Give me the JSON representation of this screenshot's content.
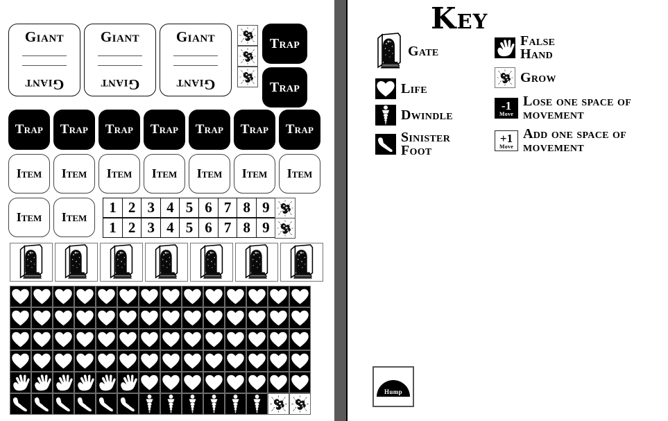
{
  "left_panel": {
    "giant_cards": [
      {
        "top_label": "Giant",
        "bottom_label": "Giant"
      },
      {
        "top_label": "Giant",
        "bottom_label": "Giant"
      },
      {
        "top_label": "Giant",
        "bottom_label": "Giant"
      }
    ],
    "grow_stack_count": 3,
    "trap_stack": [
      "Trap",
      "Trap"
    ],
    "trap_row": [
      "Trap",
      "Trap",
      "Trap",
      "Trap",
      "Trap",
      "Trap",
      "Trap"
    ],
    "item_row_1": [
      "Item",
      "Item",
      "Item",
      "Item",
      "Item",
      "Item",
      "Item"
    ],
    "item_row_2": [
      "Item",
      "Item"
    ],
    "number_strips": [
      {
        "numbers": [
          "1",
          "2",
          "3",
          "4",
          "5",
          "6",
          "7",
          "8",
          "9"
        ],
        "end_token": "grow-icon"
      },
      {
        "numbers": [
          "1",
          "2",
          "3",
          "4",
          "5",
          "6",
          "7",
          "8",
          "9"
        ],
        "end_token": "grow-icon"
      }
    ],
    "gate_row_count": 7,
    "token_grid": {
      "columns": 14,
      "rows": [
        [
          "life",
          "life",
          "life",
          "life",
          "life",
          "life",
          "life",
          "life",
          "life",
          "life",
          "life",
          "life",
          "life",
          "life"
        ],
        [
          "life",
          "life",
          "life",
          "life",
          "life",
          "life",
          "life",
          "life",
          "life",
          "life",
          "life",
          "life",
          "life",
          "life"
        ],
        [
          "life",
          "life",
          "life",
          "life",
          "life",
          "life",
          "life",
          "life",
          "life",
          "life",
          "life",
          "life",
          "life",
          "life"
        ],
        [
          "life",
          "life",
          "life",
          "life",
          "life",
          "life",
          "life",
          "life",
          "life",
          "life",
          "life",
          "life",
          "life",
          "life"
        ],
        [
          "false-hand",
          "false-hand",
          "false-hand",
          "false-hand",
          "false-hand",
          "false-hand",
          "life",
          "life",
          "life",
          "life",
          "life",
          "life",
          "life",
          "life"
        ],
        [
          "sinister-foot",
          "sinister-foot",
          "sinister-foot",
          "sinister-foot",
          "sinister-foot",
          "sinister-foot",
          "dwindle",
          "dwindle",
          "dwindle",
          "dwindle",
          "dwindle",
          "dwindle",
          "grow",
          "grow"
        ]
      ]
    }
  },
  "key": {
    "title": "Key",
    "left_entries": [
      {
        "icon": "gate-icon",
        "label": "Gate"
      },
      {
        "icon": "life-icon",
        "label": "Life"
      },
      {
        "icon": "dwindle-icon",
        "label": "Dwindle"
      },
      {
        "icon": "sinister-foot-icon",
        "label": "Sinister\nFoot"
      }
    ],
    "right_entries": [
      {
        "icon": "false-hand-icon",
        "label": "False\nHand"
      },
      {
        "icon": "grow-icon",
        "label": "Grow"
      },
      {
        "icon": "minus-one-move-icon",
        "badge_num": "-1",
        "badge_word": "Move",
        "label": "Lose one space of\nmovement"
      },
      {
        "icon": "plus-one-move-icon",
        "badge_num": "+1",
        "badge_word": "Move",
        "label": "Add one space of\nmovement"
      }
    ]
  },
  "hump": {
    "label": "Hump"
  },
  "colors": {
    "ink": "#000000",
    "paper": "#ffffff",
    "divider": "#5a5a5a"
  }
}
